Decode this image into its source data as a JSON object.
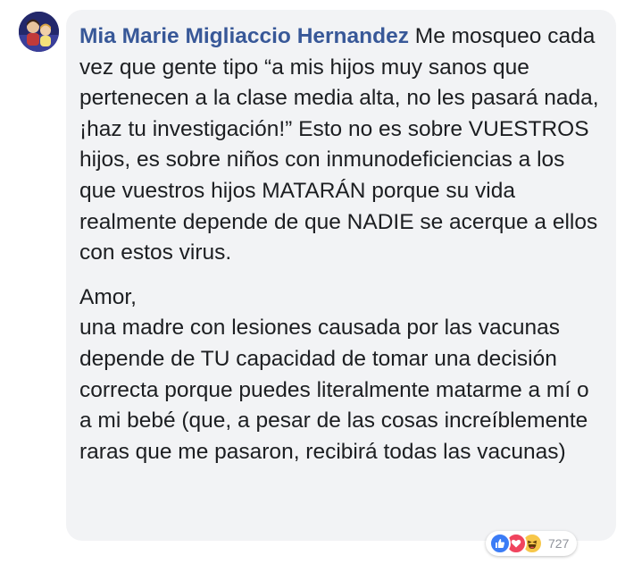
{
  "comment": {
    "author": "Mia Marie Migliaccio Hernandez",
    "paragraph1": "Me mosqueo cada vez que gente tipo “a mis hijos muy sanos que pertenecen a la clase media alta, no les pasará nada, ¡haz tu investigación!” Esto no es sobre VUESTROS hijos, es sobre niños con inmunodeficiencias a los que vuestros hijos MATARÁN porque su vida realmente depende de que NADIE se acerque a ellos con estos virus.",
    "paragraph2_line1": "Amor,",
    "paragraph2_rest": "una madre con lesiones causada por las vacunas depende de TU capacidad de tomar una decisión correcta porque puedes literalmente matarme a mí o a mi bebé (que, a pesar de las cosas increíblemente raras que me pasaron, recibirá todas las vacunas)"
  },
  "reactions": {
    "icons": [
      "like-icon",
      "love-icon",
      "haha-icon"
    ],
    "count": "727"
  },
  "colors": {
    "author": "#385898",
    "bubble": "#f2f3f5",
    "text": "#1c1e21",
    "like": "#3b7cf6",
    "love": "#f0445e",
    "haha": "#f7c74a"
  }
}
